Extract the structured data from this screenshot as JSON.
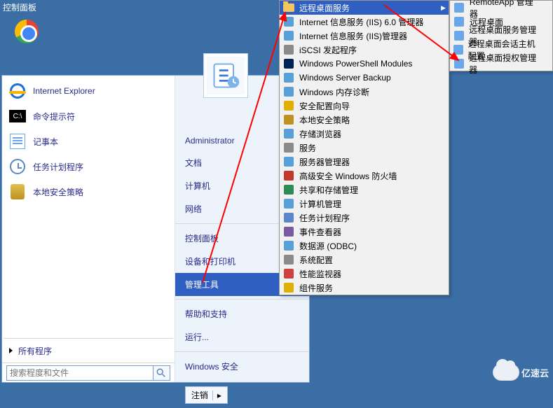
{
  "cp_label": "控制面板",
  "desktop": {
    "chrome_selected": true
  },
  "start": {
    "left_items": [
      {
        "name": "ie",
        "label": "Internet Explorer"
      },
      {
        "name": "cmd",
        "label": "命令提示符"
      },
      {
        "name": "notepad",
        "label": "记事本"
      },
      {
        "name": "taskschd",
        "label": "任务计划程序"
      },
      {
        "name": "secpol",
        "label": "本地安全策略"
      }
    ],
    "all_programs": "所有程序",
    "search_placeholder": "搜索程度和文件",
    "right_items": {
      "admin": "Administrator",
      "docs": "文档",
      "computer": "计算机",
      "network": "网络",
      "control_panel": "控制面板",
      "devices": "设备和打印机",
      "admin_tools": "管理工具",
      "help": "帮助和支持",
      "run": "运行...",
      "win_security": "Windows 安全"
    },
    "logout_label": "注销"
  },
  "admin_tools": [
    {
      "id": "rds",
      "label": "远程桌面服务",
      "has_sub": true,
      "icon": "folder",
      "selected": true
    },
    {
      "id": "iis6",
      "label": "Internet 信息服务 (IIS) 6.0 管理器",
      "icon": "iis"
    },
    {
      "id": "iis",
      "label": "Internet 信息服务 (IIS)管理器",
      "icon": "iis"
    },
    {
      "id": "iscsi",
      "label": "iSCSI 发起程序",
      "icon": "gear"
    },
    {
      "id": "psmod",
      "label": "Windows PowerShell Modules",
      "icon": "ps"
    },
    {
      "id": "wsb",
      "label": "Windows Server Backup",
      "icon": "backup"
    },
    {
      "id": "memdiag",
      "label": "Windows 内存诊断",
      "icon": "mem"
    },
    {
      "id": "scw",
      "label": "安全配置向导",
      "icon": "shield"
    },
    {
      "id": "lsp",
      "label": "本地安全策略",
      "icon": "secpol"
    },
    {
      "id": "storexp",
      "label": "存储浏览器",
      "icon": "store"
    },
    {
      "id": "services",
      "label": "服务",
      "icon": "gear"
    },
    {
      "id": "srvmgr",
      "label": "服务器管理器",
      "icon": "server"
    },
    {
      "id": "wfas",
      "label": "高级安全 Windows 防火墙",
      "icon": "fw"
    },
    {
      "id": "share",
      "label": "共享和存储管理",
      "icon": "share"
    },
    {
      "id": "compmgmt",
      "label": "计算机管理",
      "icon": "comp"
    },
    {
      "id": "tsched",
      "label": "任务计划程序",
      "icon": "sched"
    },
    {
      "id": "evtvwr",
      "label": "事件查看器",
      "icon": "event"
    },
    {
      "id": "odbc",
      "label": "数据源 (ODBC)",
      "icon": "odbc"
    },
    {
      "id": "sysconf",
      "label": "系统配置",
      "icon": "sysconf"
    },
    {
      "id": "perfmon",
      "label": "性能监视器",
      "icon": "perf"
    },
    {
      "id": "comsvc",
      "label": "组件服务",
      "icon": "com"
    }
  ],
  "rds_sub": [
    {
      "id": "remoteapp",
      "label": "RemoteApp 管理器"
    },
    {
      "id": "rd",
      "label": "远程桌面"
    },
    {
      "id": "rdsmgr",
      "label": "远程桌面服务管理器"
    },
    {
      "id": "rdsh",
      "label": "远程桌面会话主机配置"
    },
    {
      "id": "rdlic",
      "label": "远程桌面授权管理器"
    }
  ],
  "watermark": "亿速云"
}
